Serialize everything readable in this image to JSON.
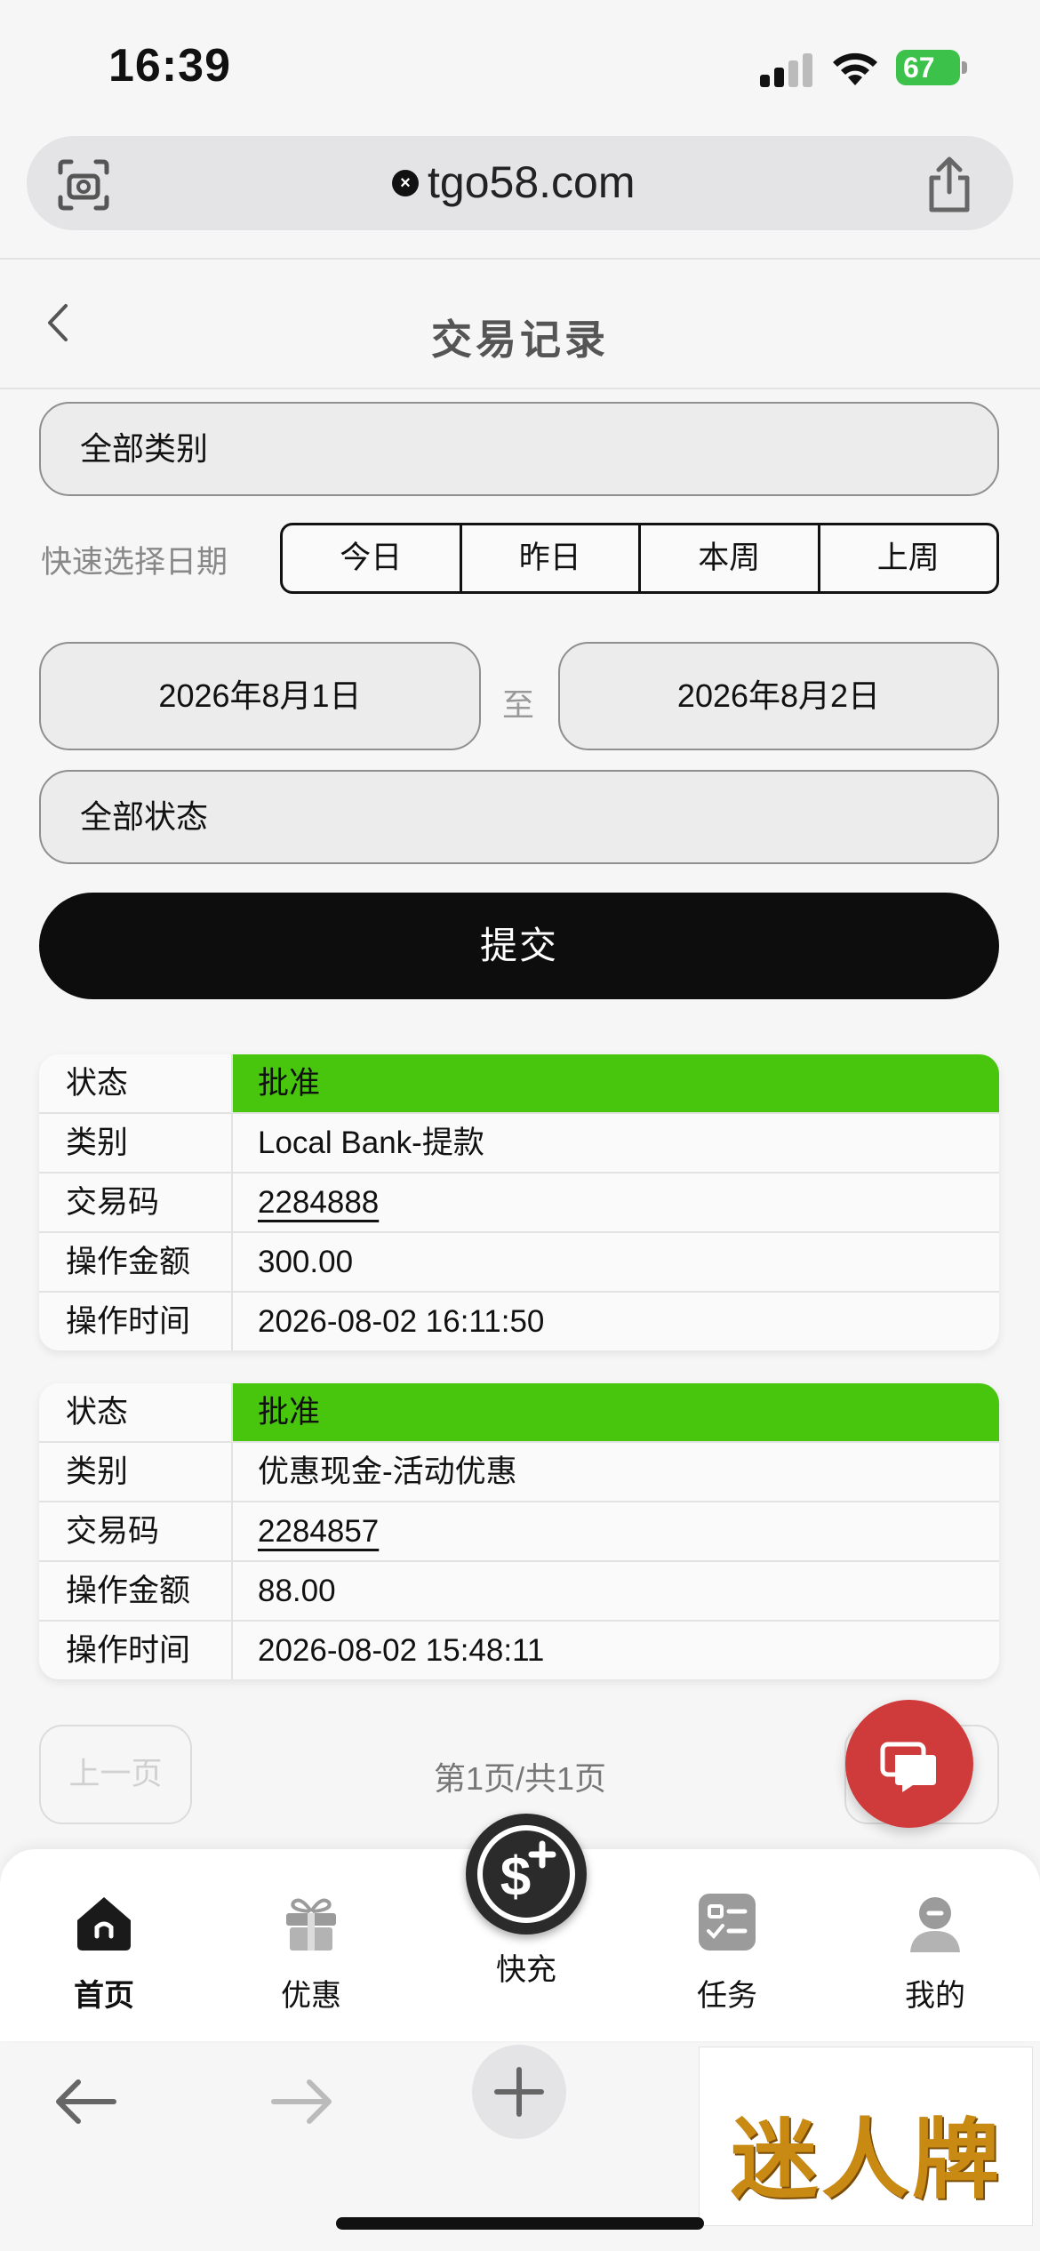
{
  "status_bar": {
    "time": "16:39",
    "battery": "67"
  },
  "browser": {
    "url": "tgo58.com"
  },
  "header": {
    "title": "交易记录"
  },
  "filters": {
    "category": "全部类别",
    "quick_date_label": "快速选择日期",
    "quick_dates": [
      "今日",
      "昨日",
      "本周",
      "上周"
    ],
    "start_date": "2026年8月1日",
    "to_label": "至",
    "end_date": "2026年8月2日",
    "status": "全部状态",
    "submit_label": "提交"
  },
  "records": [
    {
      "status_label": "状态",
      "status": "批准",
      "category_label": "类别",
      "category": "Local Bank-提款",
      "code_label": "交易码",
      "code": "2284888",
      "amount_label": "操作金额",
      "amount": "300.00",
      "time_label": "操作时间",
      "time": "2026-08-02 16:11:50"
    },
    {
      "status_label": "状态",
      "status": "批准",
      "category_label": "类别",
      "category": "优惠现金-活动优惠",
      "code_label": "交易码",
      "code": "2284857",
      "amount_label": "操作金额",
      "amount": "88.00",
      "time_label": "操作时间",
      "time": "2026-08-02 15:48:11"
    }
  ],
  "pagination": {
    "prev_label": "上一页",
    "info": "第1页/共1页"
  },
  "tabbar": {
    "home": "首页",
    "promo": "优惠",
    "fast": "快充",
    "tasks": "任务",
    "mine": "我的"
  },
  "ad": {
    "text": "迷人牌"
  },
  "colors": {
    "status_green": "#48c60e",
    "chat_red": "#cf3b3b",
    "battery_green": "#3cc24a"
  }
}
